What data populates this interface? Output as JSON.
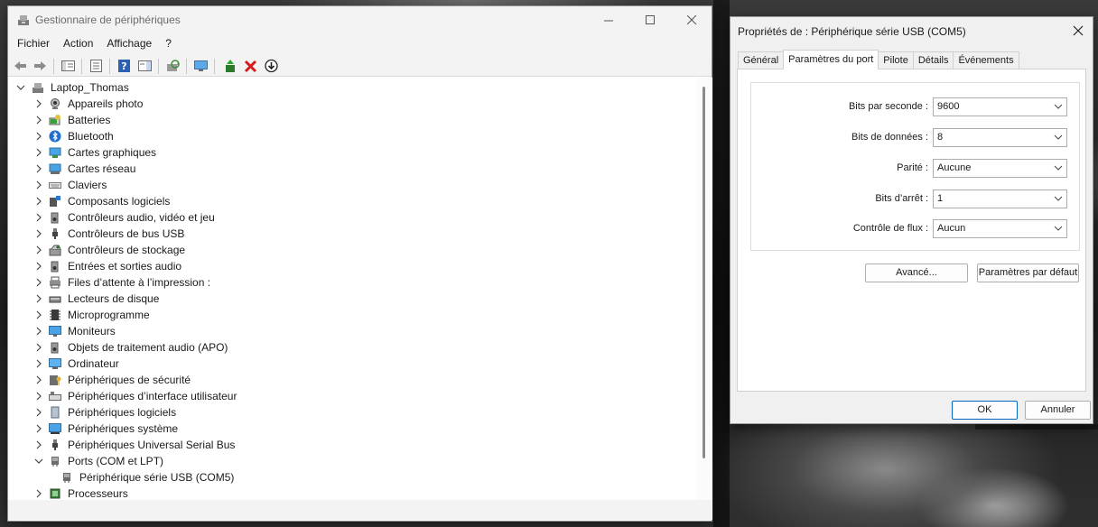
{
  "device_manager": {
    "title": "Gestionnaire de périphériques",
    "menu": [
      "Fichier",
      "Action",
      "Affichage",
      "?"
    ],
    "root": "Laptop_Thomas",
    "categories": [
      {
        "label": "Appareils photo",
        "icon": "camera-icon"
      },
      {
        "label": "Batteries",
        "icon": "battery-icon"
      },
      {
        "label": "Bluetooth",
        "icon": "bluetooth-icon"
      },
      {
        "label": "Cartes graphiques",
        "icon": "display-adapter-icon"
      },
      {
        "label": "Cartes réseau",
        "icon": "network-adapter-icon"
      },
      {
        "label": "Claviers",
        "icon": "keyboard-icon"
      },
      {
        "label": "Composants logiciels",
        "icon": "software-component-icon"
      },
      {
        "label": "Contrôleurs audio, vidéo et jeu",
        "icon": "speaker-icon"
      },
      {
        "label": "Contrôleurs de bus USB",
        "icon": "usb-icon"
      },
      {
        "label": "Contrôleurs de stockage",
        "icon": "storage-controller-icon"
      },
      {
        "label": "Entrées et sorties audio",
        "icon": "speaker-icon"
      },
      {
        "label": "Files d’attente à l’impression :",
        "icon": "printer-icon"
      },
      {
        "label": "Lecteurs de disque",
        "icon": "disk-drive-icon"
      },
      {
        "label": "Microprogramme",
        "icon": "firmware-icon"
      },
      {
        "label": "Moniteurs",
        "icon": "monitor-icon"
      },
      {
        "label": "Objets de traitement audio (APO)",
        "icon": "speaker-icon"
      },
      {
        "label": "Ordinateur",
        "icon": "computer-icon"
      },
      {
        "label": "Périphériques de sécurité",
        "icon": "security-device-icon"
      },
      {
        "label": "Périphériques d’interface utilisateur",
        "icon": "hid-icon"
      },
      {
        "label": "Périphériques logiciels",
        "icon": "software-device-icon"
      },
      {
        "label": "Périphériques système",
        "icon": "system-device-icon"
      },
      {
        "label": "Périphériques Universal Serial Bus",
        "icon": "usb-icon"
      },
      {
        "label": "Ports (COM et LPT)",
        "icon": "port-icon",
        "expanded": true
      },
      {
        "label": "Périphérique série USB (COM5)",
        "icon": "port-icon",
        "child": true
      },
      {
        "label": "Processeurs",
        "icon": "processor-icon"
      }
    ]
  },
  "properties": {
    "title": "Propriétés de : Périphérique série USB (COM5)",
    "tabs": [
      "Général",
      "Paramètres du port",
      "Pilote",
      "Détails",
      "Événements"
    ],
    "active_tab": "Paramètres du port",
    "fields": [
      {
        "label": "Bits par seconde :",
        "value": "9600"
      },
      {
        "label": "Bits de données :",
        "value": "8"
      },
      {
        "label": "Parité :",
        "value": "Aucune"
      },
      {
        "label": "Bits d’arrêt :",
        "value": "1"
      },
      {
        "label": "Contrôle de flux :",
        "value": "Aucun"
      }
    ],
    "advanced_button": "Avancé...",
    "defaults_button": "Paramètres par défaut",
    "ok_button": "OK",
    "cancel_button": "Annuler"
  },
  "colors": {
    "accent": "#0067c0",
    "window_bg": "#ffffff",
    "dialog_bg": "#f0f0f0"
  }
}
